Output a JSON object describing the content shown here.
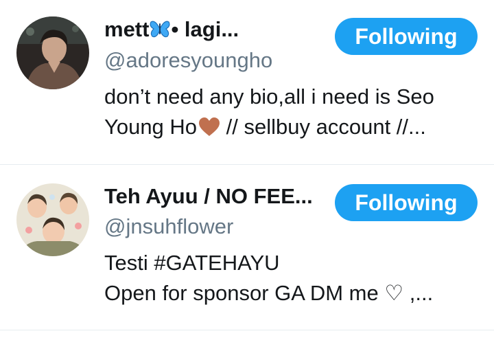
{
  "accounts": [
    {
      "name_part1": "mett",
      "name_part2": "• lagi...",
      "name_icon": "butterfly-icon",
      "handle": "@adoresyoungho",
      "bio_line1": "don’t need any bio,all i need is Seo",
      "bio_line2a": "Young Ho",
      "bio_line2_icon": "brown-heart-icon",
      "bio_line2b": " // sellbuy account //...",
      "follow_label": "Following"
    },
    {
      "name": "Teh Ayuu / NO FEE...",
      "handle": "@jnsuhflower",
      "bio_line1": "Testi #GATEHAYU",
      "bio_line2": "Open for sponsor GA DM me ♡ ,...",
      "follow_label": "Following"
    }
  ],
  "colors": {
    "accent": "#1da1f2",
    "handle": "#657786",
    "text": "#14171a",
    "divider": "#e6ecf0"
  }
}
